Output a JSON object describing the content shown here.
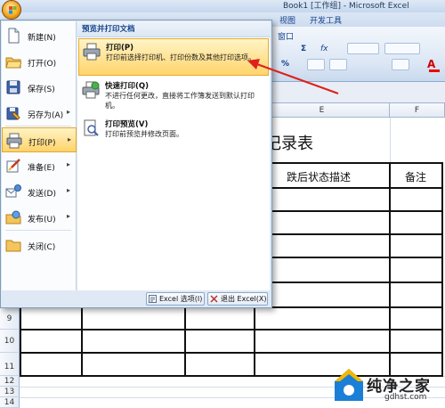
{
  "window": {
    "title": "Book1 [工作组] - Microsoft Excel"
  },
  "ribbon": {
    "tabs": [
      "视图",
      "开发工具"
    ],
    "visible_snippets": {
      "window_group": "窗口",
      "sigma": "Σ",
      "percent": "%",
      "fx": "fx"
    }
  },
  "sheet": {
    "columns": [
      "E",
      "F"
    ],
    "rows": [
      "9",
      "10",
      "11",
      "12",
      "13",
      "14"
    ],
    "title_fragment": "记录表",
    "table_headers": [
      "跌后状态描述",
      "备注"
    ]
  },
  "office_menu": {
    "left_items": [
      {
        "label": "新建(N)",
        "icon": "new-document-icon"
      },
      {
        "label": "打开(O)",
        "icon": "open-folder-icon"
      },
      {
        "label": "保存(S)",
        "icon": "save-disk-icon"
      },
      {
        "label": "另存为(A)",
        "icon": "save-as-icon",
        "has_submenu": true
      },
      {
        "label": "打印(P)",
        "icon": "printer-icon",
        "has_submenu": true,
        "selected": true
      },
      {
        "label": "准备(E)",
        "icon": "prepare-icon",
        "has_submenu": true
      },
      {
        "label": "发送(D)",
        "icon": "send-icon",
        "has_submenu": true
      },
      {
        "label": "发布(U)",
        "icon": "publish-icon",
        "has_submenu": true
      },
      {
        "label": "关闭(C)",
        "icon": "close-folder-icon"
      }
    ],
    "right_header": "预览并打印文档",
    "right_options": [
      {
        "title": "打印(P)",
        "description": "打印前选择打印机、打印份数及其他打印选项。",
        "icon": "printer-icon",
        "selected": true
      },
      {
        "title": "快速打印(Q)",
        "description": "不进行任何更改，直接将工作簿发送到默认打印机。",
        "icon": "quick-print-icon"
      },
      {
        "title": "打印预览(V)",
        "description": "打印前预览并修改页面。",
        "icon": "print-preview-icon"
      }
    ],
    "footer": {
      "options_button": "Excel 选项(I)",
      "exit_button": "退出 Excel(X)"
    }
  },
  "watermark": {
    "text": "纯净之家",
    "url": "gdhst.com"
  },
  "colors": {
    "highlight": "#ffd46b",
    "menu_bg": "#dfe9f5",
    "arrow": "#e0201b",
    "ribbon_text": "#15428b"
  }
}
